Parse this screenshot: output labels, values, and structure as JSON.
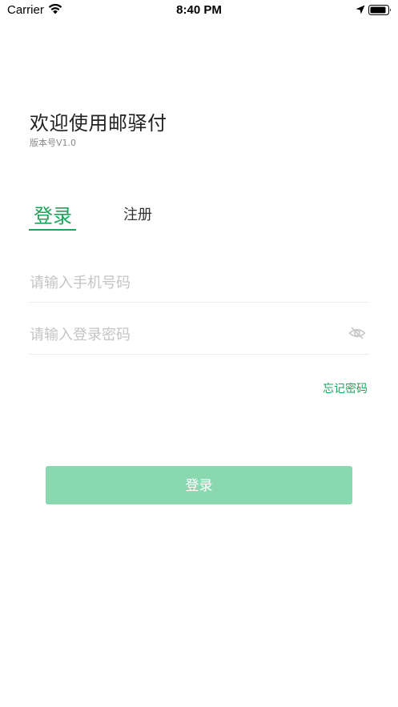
{
  "status_bar": {
    "carrier": "Carrier",
    "time": "8:40 PM",
    "icons": [
      "wifi-icon",
      "location-arrow-icon",
      "battery-icon"
    ]
  },
  "welcome": {
    "title": "欢迎使用邮驿付",
    "version": "版本号V1.0"
  },
  "tabs": {
    "login": "登录",
    "register": "注册",
    "active": "login"
  },
  "form": {
    "phone_placeholder": "请输入手机号码",
    "phone_value": "",
    "password_placeholder": "请输入登录密码",
    "password_value": "",
    "password_toggle_icon": "eye-hidden-icon",
    "forgot_password": "忘记密码"
  },
  "actions": {
    "login_button": "登录"
  },
  "colors": {
    "accent": "#1aa55a",
    "button_bg": "#8ad8b0",
    "placeholder": "#c4c4c4"
  }
}
